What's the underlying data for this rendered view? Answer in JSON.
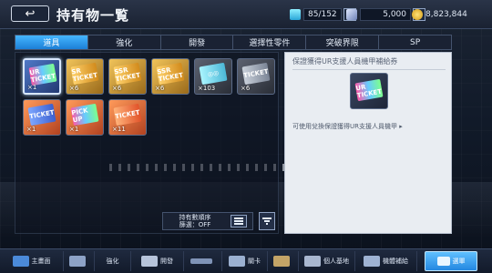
{
  "header": {
    "title": "持有物一覧",
    "back_glyph": "↩",
    "resources": [
      {
        "name": "energy",
        "value": "85/152",
        "icon": "battery-icon",
        "color": "#6fd8ff"
      },
      {
        "name": "credits",
        "value": "5,000",
        "icon": "chip-icon",
        "color": "#c7d6ff"
      },
      {
        "name": "gold",
        "value": "8,823,844",
        "icon": "coin-icon",
        "color": "#ffcc33"
      }
    ],
    "plus_glyph": "+"
  },
  "tabs": [
    {
      "label": "道具",
      "active": true
    },
    {
      "label": "強化",
      "active": false
    },
    {
      "label": "開發",
      "active": false
    },
    {
      "label": "選擇性零件",
      "active": false
    },
    {
      "label": "突破界限",
      "active": false
    },
    {
      "label": "SP",
      "active": false
    }
  ],
  "items": [
    {
      "ticket": "UR TICKET",
      "style": "t-rainbow",
      "bg": "blue",
      "count": "×1",
      "selected": true
    },
    {
      "ticket": "SR TICKET",
      "style": "t-gold",
      "bg": "gold",
      "count": "×6",
      "selected": false
    },
    {
      "ticket": "SSR TICKET",
      "style": "t-gold",
      "bg": "gold",
      "count": "×6",
      "selected": false
    },
    {
      "ticket": "SSR TICKET",
      "style": "t-gold",
      "bg": "gold",
      "count": "×6",
      "selected": false
    },
    {
      "ticket": "◎◎",
      "style": "t-cyan",
      "bg": "dark",
      "count": "×103",
      "selected": false
    },
    {
      "ticket": "TICKET",
      "style": "t-gray",
      "bg": "dark",
      "count": "×6",
      "selected": false
    },
    {
      "ticket": "TICKET",
      "style": "t-blue",
      "bg": "orange",
      "count": "×1",
      "selected": false
    },
    {
      "ticket": "PICK UP",
      "style": "t-rainbow",
      "bg": "orange",
      "count": "×1",
      "selected": false
    },
    {
      "ticket": "TICKET",
      "style": "t-orange",
      "bg": "orange",
      "count": "×11",
      "selected": false
    }
  ],
  "sort": {
    "label_line1": "持有數順序",
    "label_line2": "篩選：OFF"
  },
  "detail": {
    "title": "保證獲得UR支援人員機甲補給券",
    "ticket": "UR TICKET",
    "description": "可使用兌換保證獲得UR支援人員機甲 ▸"
  },
  "bottom_nav": [
    {
      "label": "主畫面",
      "icon": "home-icon",
      "active": false
    },
    {
      "label": "",
      "icon": "mech-icon",
      "active": false
    },
    {
      "label": "強化",
      "icon": "upgrade-icon",
      "active": false
    },
    {
      "label": "開發",
      "icon": "factory-icon",
      "active": false
    },
    {
      "label": "",
      "icon": "gun-icon",
      "active": false
    },
    {
      "label": "關卡",
      "icon": "stage-icon",
      "active": false
    },
    {
      "label": "",
      "icon": "chest-icon",
      "active": false
    },
    {
      "label": "個人基地",
      "icon": "base-icon",
      "active": false
    },
    {
      "label": "機體補給",
      "icon": "supply-icon",
      "active": false
    },
    {
      "label": "選單",
      "icon": "menu-icon",
      "active": true
    }
  ]
}
